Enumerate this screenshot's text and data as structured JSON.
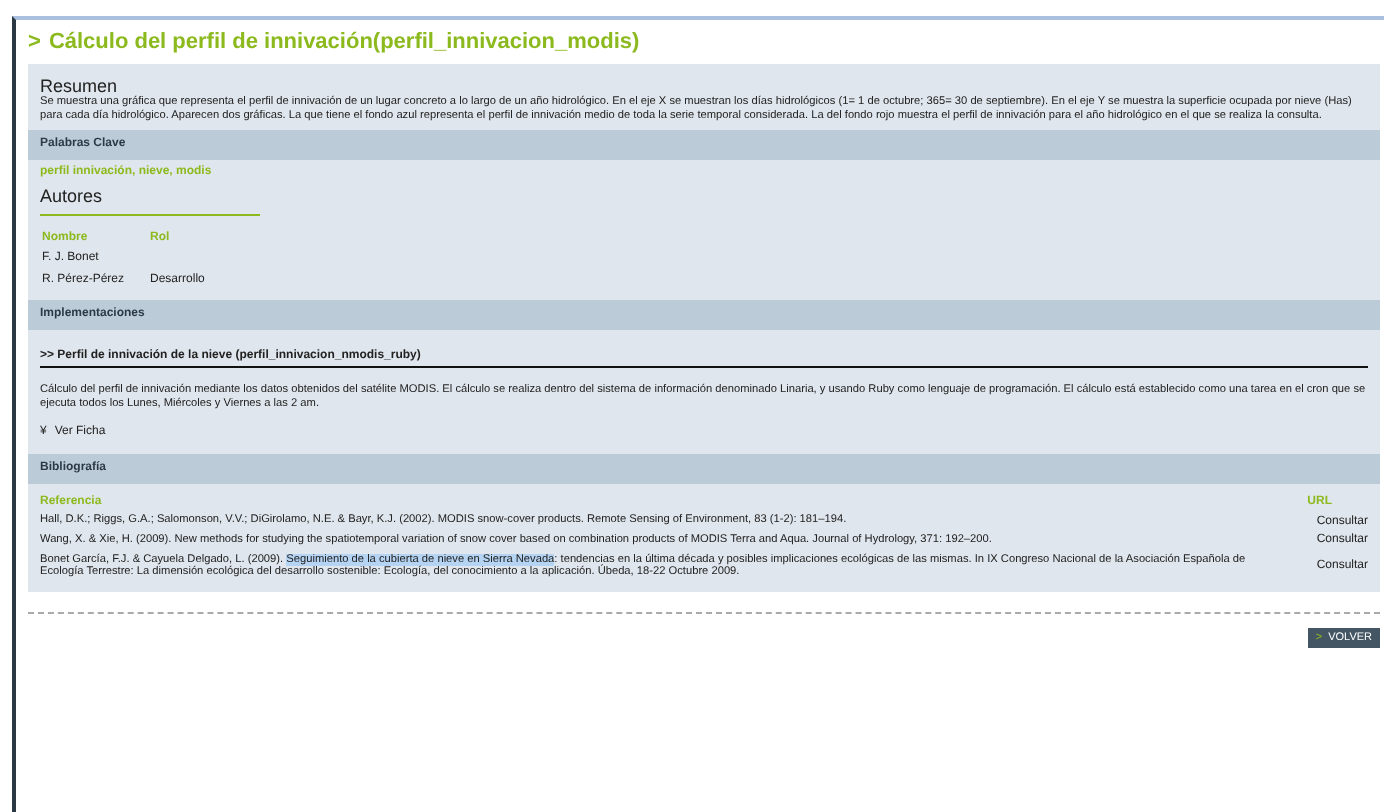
{
  "title": {
    "arrow": ">",
    "text": "Cálculo del perfil de innivación(perfil_innivacion_modis)"
  },
  "summary": {
    "heading": "Resumen",
    "text": "Se muestra una gráfica que representa el perfil de innivación de un lugar concreto a lo largo de un año hidrológico. En el eje X se muestran los días hidrológicos (1= 1 de octubre; 365= 30 de septiembre). En el eje Y se muestra la superficie ocupada por nieve (Has) para cada día hidrológico. Aparecen dos gráficas. La que tiene el fondo azul representa el perfil de innivación medio de toda la serie temporal considerada. La del fondo rojo muestra el perfil de innivación para el año hidrológico en el que se realiza la consulta."
  },
  "keywords": {
    "heading": "Palabras Clave",
    "text": "perfil innivación, nieve, modis"
  },
  "authors": {
    "heading": "Autores",
    "columns": [
      "Nombre",
      "Rol"
    ],
    "rows": [
      [
        "F. J. Bonet",
        ""
      ],
      [
        "R. Pérez-Pérez",
        "Desarrollo"
      ]
    ]
  },
  "implementations": {
    "heading": "Implementaciones",
    "item_title": ">> Perfil de innivación de la nieve (perfil_innivacion_nmodis_ruby)",
    "description": "Cálculo del perfil de innivación mediante los datos obtenidos del satélite MODIS. El cálculo se realiza dentro del sistema de información denominado Linaria, y usando Ruby como lenguaje de programación. El cálculo está establecido como una tarea en el cron que se ejecuta todos los Lunes, Miércoles y Viernes a las 2 am.",
    "link_icon": "¥",
    "link": "Ver Ficha"
  },
  "bibliography": {
    "heading": "Bibliografía",
    "columns": [
      "Referencia",
      "URL"
    ],
    "references": [
      {
        "segments": [
          {
            "text": "Hall, D.K.; Riggs, G.A.; Salomonson, V.V.; DiGirolamo, N.E. & Bayr, K.J. (2002). MODIS snow-cover products. Remote Sensing of Environment, 83 (1-2): 181–194.",
            "highlighted": false
          }
        ],
        "url": "Consultar"
      },
      {
        "segments": [
          {
            "text": "Wang, X. & Xie, H. (2009). New methods for studying the spatiotemporal variation of snow cover based on combination products of MODIS Terra and Aqua. Journal of Hydrology, 371: 192–200.",
            "highlighted": false
          }
        ],
        "url": "Consultar"
      },
      {
        "segments": [
          {
            "text": "Bonet García, F.J. & Cayuela Delgado, L. (2009). ",
            "highlighted": false
          },
          {
            "text": "Seguimiento de la cubierta de nieve en Sierra Nevada",
            "highlighted": true
          },
          {
            "text": ": tendencias en la última década y posibles implicaciones ecológicas de las mismas. In IX Congreso Nacional de la Asociación Española de Ecología Terrestre: La dimensión ecológica del desarrollo sostenible: Ecología, del conocimiento a la aplicación. Úbeda, 18-22 Octubre 2009.",
            "highlighted": false
          }
        ],
        "url": "Consultar"
      }
    ]
  },
  "back_button": {
    "arrow": ">",
    "label": "VOLVER"
  }
}
